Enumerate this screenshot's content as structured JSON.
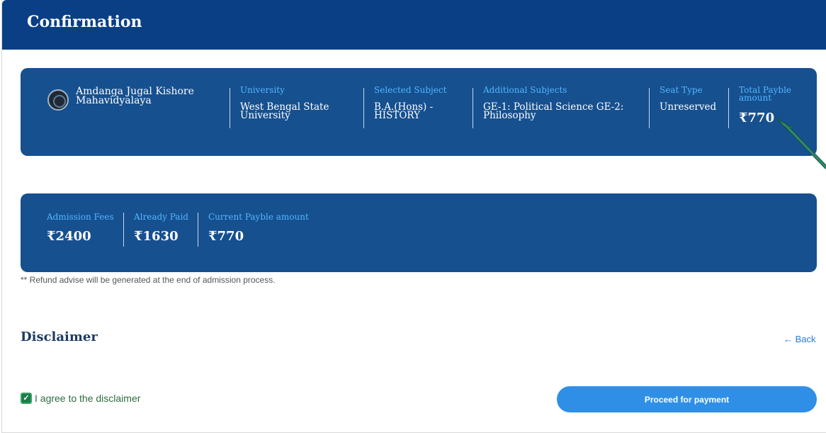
{
  "header": {
    "title": "Confirmation"
  },
  "college": {
    "name": "Amdanga Jugal Kishore Mahavidyalaya",
    "logo_icon": "college-seal-icon"
  },
  "summary": {
    "university": {
      "label": "University",
      "value": "West Bengal State University"
    },
    "subject": {
      "label": "Selected Subject",
      "value": "B.A.(Hons) - HISTORY"
    },
    "additional": {
      "label": "Additional Subjects",
      "value": "GE-1: Political Science GE-2: Philosophy"
    },
    "seat": {
      "label": "Seat Type",
      "value": "Unreserved"
    },
    "total": {
      "label": "Total Payble amount",
      "value": "₹770"
    }
  },
  "fees": {
    "admission": {
      "label": "Admission Fees",
      "value": "₹2400"
    },
    "paid": {
      "label": "Already Paid",
      "value": "₹1630"
    },
    "current": {
      "label": "Current Payble amount",
      "value": "₹770"
    }
  },
  "note": "** Refund advise will be generated at the end of admission process.",
  "disclaimer": {
    "title": "Disclaimer",
    "back_label": "← Back"
  },
  "agree": {
    "label": "I agree to the disclaimer",
    "checked": true,
    "check_glyph": "✓"
  },
  "actions": {
    "proceed_label": "Proceed for payment"
  },
  "colors": {
    "header": "#0a3f86",
    "card": "#16508f",
    "label_blue": "#52b6ff",
    "button": "#2f8fe6",
    "checkbox": "#1f7a4a"
  }
}
